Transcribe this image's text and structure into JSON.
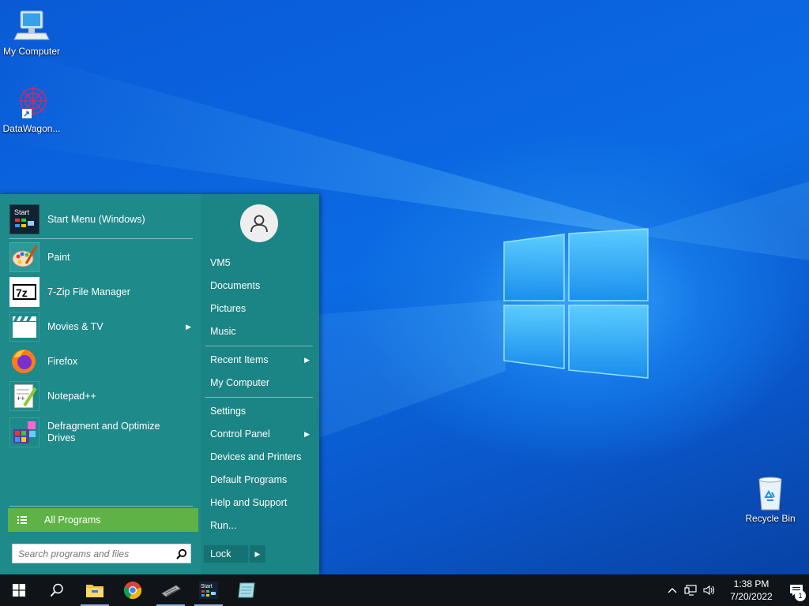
{
  "desktop": {
    "icons": [
      {
        "label": "My Computer",
        "icon": "computer-icon"
      },
      {
        "label": "DataWagon...",
        "icon": "datawagon-icon"
      },
      {
        "label": "Recycle Bin",
        "icon": "recycle-bin-icon"
      }
    ]
  },
  "start_menu": {
    "pinned": [
      {
        "label": "Start Menu (Windows)",
        "icon": "start-menu-icon"
      }
    ],
    "recent": [
      {
        "label": "Paint",
        "icon": "paint-icon"
      },
      {
        "label": "7-Zip File Manager",
        "icon": "7zip-icon"
      },
      {
        "label": "Movies & TV",
        "icon": "movies-tv-icon",
        "has_submenu": true
      },
      {
        "label": "Firefox",
        "icon": "firefox-icon"
      },
      {
        "label": "Notepad++",
        "icon": "notepad-plus-plus-icon"
      },
      {
        "label": "Defragment and Optimize Drives",
        "icon": "defragment-icon"
      }
    ],
    "all_programs_label": "All Programs",
    "search_placeholder": "Search programs and files",
    "right_items": [
      {
        "label": "VM5"
      },
      {
        "label": "Documents"
      },
      {
        "label": "Pictures"
      },
      {
        "label": "Music"
      },
      {
        "label": "Recent Items",
        "has_submenu": true
      },
      {
        "label": "My Computer"
      },
      {
        "label": "Settings"
      },
      {
        "label": "Control Panel",
        "has_submenu": true
      },
      {
        "label": "Devices and Printers"
      },
      {
        "label": "Default Programs"
      },
      {
        "label": "Help and Support"
      },
      {
        "label": "Run..."
      }
    ],
    "lock_label": "Lock",
    "colors": {
      "background": "#1e8a8a",
      "all_programs": "#5fb346"
    }
  },
  "taskbar": {
    "apps": [
      {
        "name": "start-button",
        "icon": "windows-logo-icon"
      },
      {
        "name": "search-button",
        "icon": "search-icon"
      },
      {
        "name": "file-explorer",
        "icon": "folder-icon"
      },
      {
        "name": "chrome",
        "icon": "chrome-icon"
      },
      {
        "name": "app-keyboard",
        "icon": "keyboard-icon"
      },
      {
        "name": "start-menu-app",
        "icon": "start-menu-icon"
      },
      {
        "name": "app-notebook",
        "icon": "notebook-icon"
      }
    ],
    "time": "1:38 PM",
    "date": "7/20/2022",
    "notification_count": "1"
  }
}
